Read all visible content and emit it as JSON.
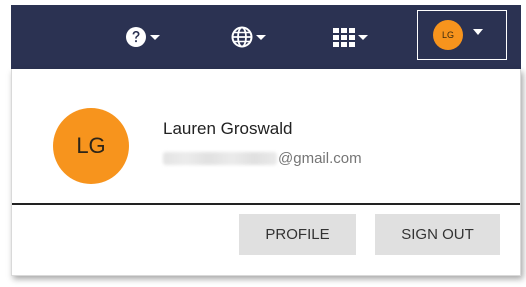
{
  "topbar": {
    "background": "#2b3252",
    "help": {
      "icon": "help-circle-icon"
    },
    "language": {
      "icon": "globe-icon"
    },
    "apps": {
      "icon": "grid-icon"
    },
    "user_initials": "LG"
  },
  "menu": {
    "avatar_initials": "LG",
    "avatar_color": "#f7941d",
    "name": "Lauren Groswald",
    "email_domain": "@gmail.com",
    "profile_label": "PROFILE",
    "signout_label": "SIGN OUT"
  }
}
